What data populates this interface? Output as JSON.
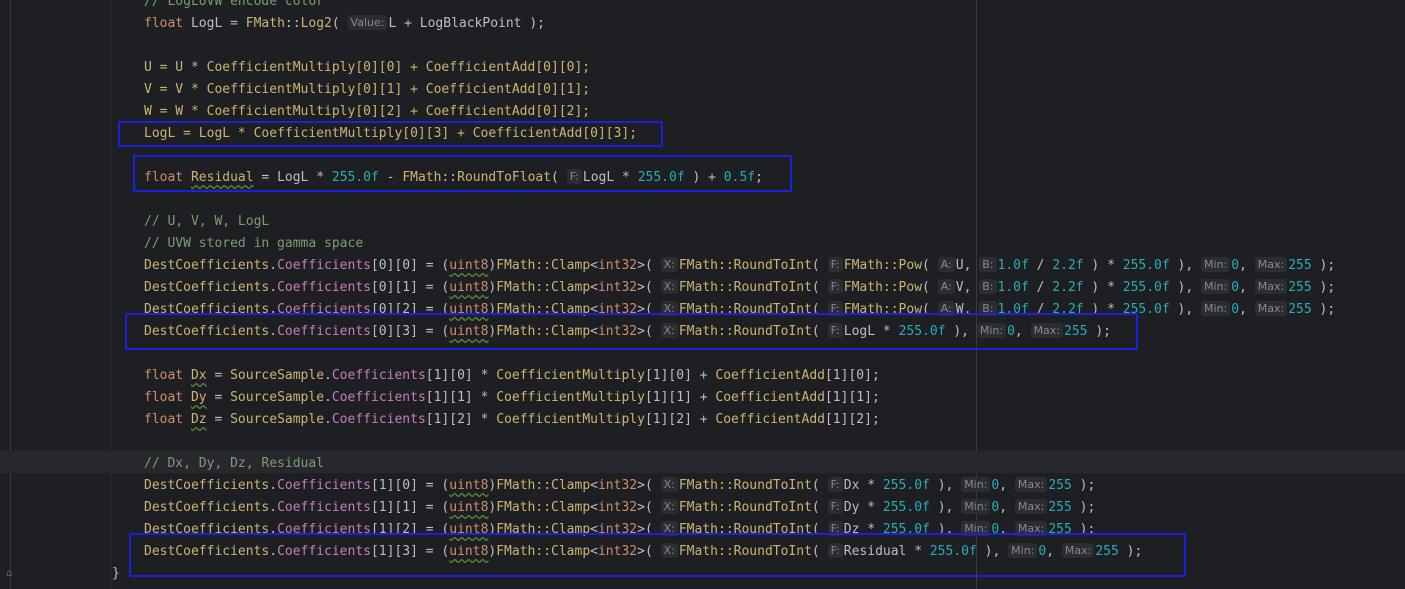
{
  "code": {
    "line_00_comment": "// LogLUVW encode color",
    "line_01": [
      "float",
      "LogL",
      " = ",
      "FMath",
      "::",
      "Log2",
      "( ",
      "Value:",
      "L + LogBlackPoint );"
    ],
    "line_03": "U = U * CoefficientMultiply[0][0] + CoefficientAdd[0][0];",
    "line_04": "V = V * CoefficientMultiply[0][1] + CoefficientAdd[0][1];",
    "line_05": "W = W * CoefficientMultiply[0][2] + CoefficientAdd[0][2];",
    "line_06": "LogL = LogL * CoefficientMultiply[0][3] + CoefficientAdd[0][3];",
    "line_08": {
      "kw": "float",
      "var": "Residual",
      "a": " = LogL * ",
      "n1": "255.0f",
      "b": " - ",
      "cls": "FMath",
      "c": "::",
      "fn": "RoundToFloat",
      "d": "( ",
      "hint": "F:",
      "e": "LogL * ",
      "n2": "255.0f",
      "f": " ) + ",
      "n3": "0.5f",
      "g": ";"
    },
    "line_10_comment": "// U, V, W, LogL",
    "line_11_comment": "// UVW stored in gamma space",
    "dest_prefix": "DestCoefficients",
    "coeff_field": "Coefficients",
    "cast": "uint8",
    "clamp": "FMath::Clamp<int32>(",
    "round": "FMath::RoundToInt(",
    "pow": "FMath::Pow(",
    "hint_x": "X:",
    "hint_f": "F:",
    "hint_a": "A:",
    "hint_b": "B:",
    "hint_min": "Min:",
    "hint_max": "Max:",
    "gamma_lines": [
      {
        "idx": "[0][0]",
        "a": "U"
      },
      {
        "idx": "[0][1]",
        "a": "V"
      },
      {
        "idx": "[0][2]",
        "a": "W"
      }
    ],
    "gamma_b": "1.0f / 2.2f",
    "line_15_idx": "[0][3]",
    "line_15_f": "LogL * 255.0f",
    "d_lines": [
      {
        "var": "Dx",
        "idx": "[1][0]"
      },
      {
        "var": "Dy",
        "idx": "[1][1]"
      },
      {
        "var": "Dz",
        "idx": "[1][2]"
      }
    ],
    "d_source": "SourceSample",
    "line_21_comment": "// Dx, Dy, Dz, Residual",
    "dest_d_lines": [
      {
        "idx": "[1][0]",
        "f": "Dx"
      },
      {
        "idx": "[1][1]",
        "f": "Dy"
      },
      {
        "idx": "[1][2]",
        "f": "Dz"
      },
      {
        "idx": "[1][3]",
        "f": "Residual"
      }
    ],
    "closing_brace": "}",
    "n255f": "255.0f",
    "n0": "0",
    "n255": "255"
  },
  "colors": {
    "highlight_box": "#1a22e0",
    "background": "#1e1f22"
  }
}
